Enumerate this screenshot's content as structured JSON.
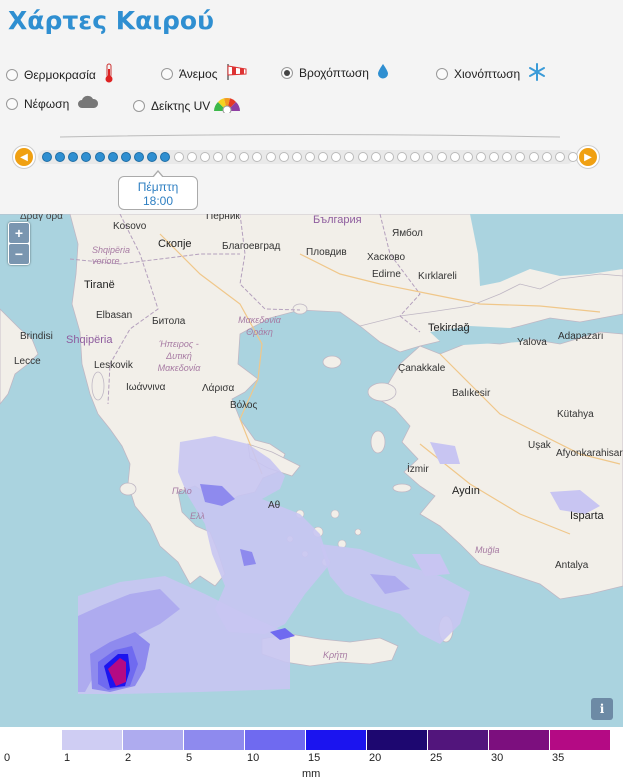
{
  "page": {
    "title": "Χάρτες Καιρού"
  },
  "layers": [
    {
      "label": "Θερμοκρασία",
      "selected": false,
      "icon": "thermometer-icon"
    },
    {
      "label": "Άνεμος",
      "selected": false,
      "icon": "windsock-icon"
    },
    {
      "label": "Βροχόπτωση",
      "selected": true,
      "icon": "raindrop-icon"
    },
    {
      "label": "Χιονόπτωση",
      "selected": false,
      "icon": "snowflake-icon"
    },
    {
      "label": "Νέφωση",
      "selected": false,
      "icon": "cloud-icon"
    },
    {
      "label": "Δείκτης UV",
      "selected": false,
      "icon": "uv-gauge-icon"
    }
  ],
  "timeline": {
    "current_day": "Πέμπτη",
    "current_time": "18:00",
    "total_steps": 41,
    "active_steps": 10
  },
  "map": {
    "zoom_in": "+",
    "zoom_out": "−",
    "info": "i",
    "labels": {
      "bulgaria": "България",
      "kosovo": "Kosovo",
      "skopje": "Скопје",
      "pernik": "Перник",
      "blagoevgrad": "Благоевград",
      "plovdiv": "Пловдив",
      "yambol": "Ямбол",
      "haskovo": "Хасково",
      "edirne": "Edirne",
      "kirklareli": "Kırklareli",
      "shqiperia_veriore": "Shqipëria veriore",
      "tirane": "Tiranë",
      "elbasan": "Elbasan",
      "shqiperia": "Shqipëria",
      "bitola": "Битола",
      "makedonia_thraki": "Μακεδονία Θράκη",
      "tekirdag": "Tekirdağ",
      "yalova": "Yalova",
      "adapazari": "Adapazarı",
      "brindisi": "Brindisi",
      "lecce": "Lecce",
      "leskovik": "Leskovik",
      "ioannina": "Ιωάννινα",
      "ipeiros": "Ήπειρος - Δυτική Μακεδονία",
      "canakkale": "Çanakkale",
      "balikesir": "Balıkesir",
      "larisa": "Λάρισα",
      "volos": "Βόλος",
      "kutahya": "Kütahya",
      "usak": "Uşak",
      "afyon": "Afyonkarahisar",
      "izmir": "İzmir",
      "aydin": "Aydın",
      "isparta": "Isparta",
      "pelo": "Πελο",
      "ell": "Ελλ",
      "athina": "Αθ",
      "mugla": "Muğla",
      "antalya": "Antalya",
      "kriti": "Κρήτη"
    }
  },
  "legend": {
    "unit": "mm",
    "ticks": [
      "0",
      "1",
      "2",
      "5",
      "10",
      "15",
      "20",
      "25",
      "30",
      "35"
    ],
    "colors": [
      "#cfcdf3",
      "#aeabef",
      "#8e8aee",
      "#6f6af0",
      "#1b14ef",
      "#1d0770",
      "#52157c",
      "#7c0f7e",
      "#b40a84"
    ]
  }
}
